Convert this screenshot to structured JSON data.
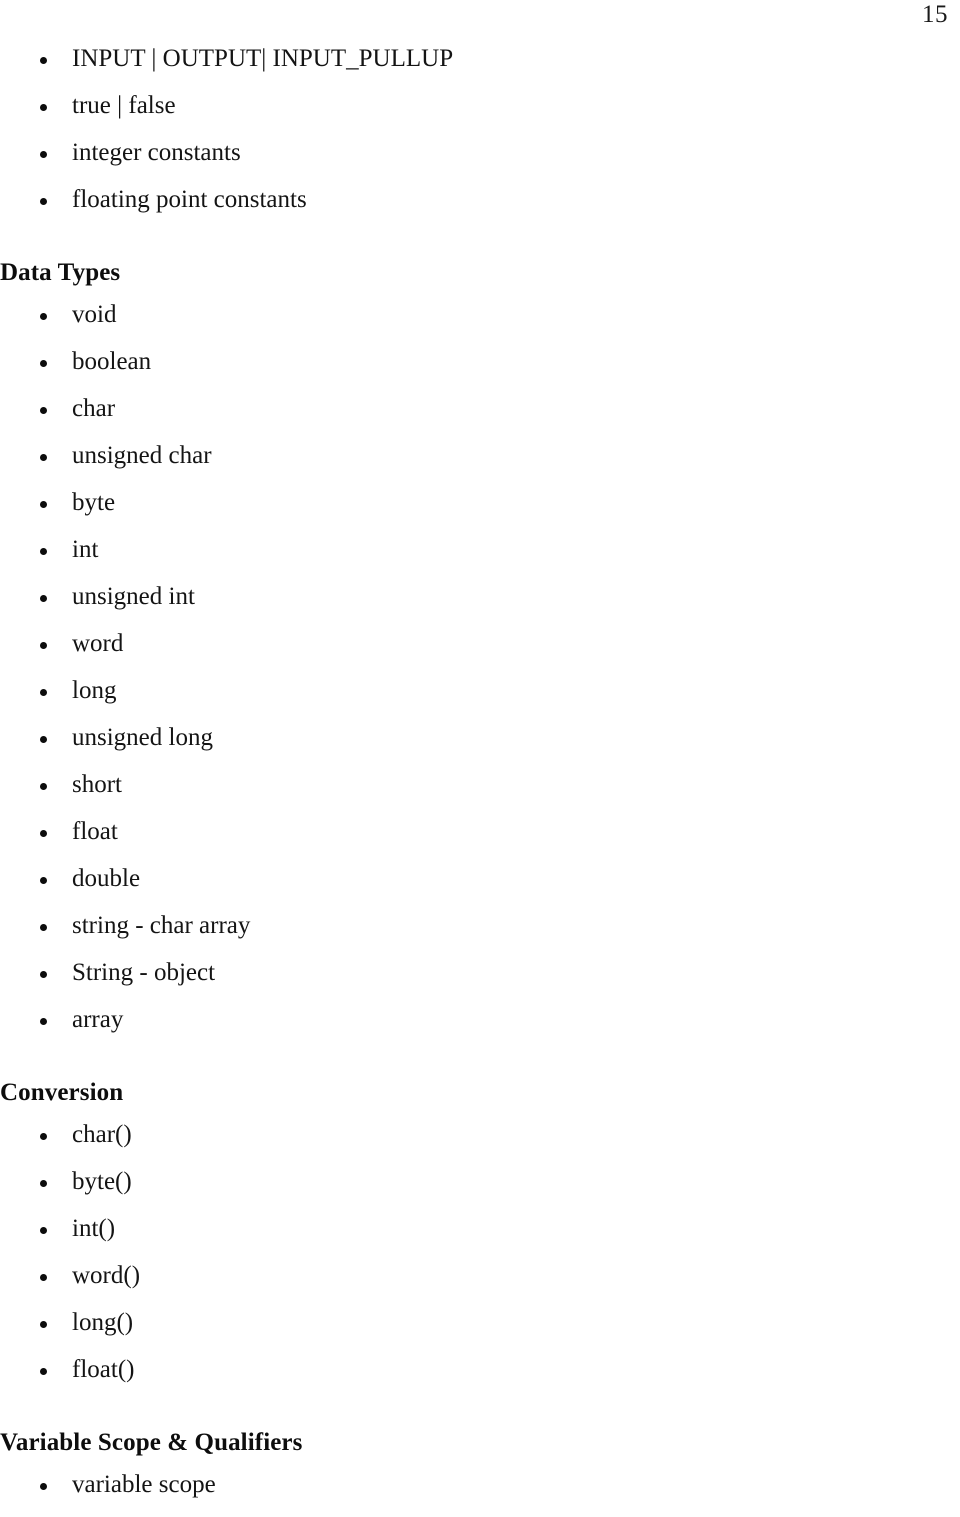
{
  "page": {
    "number": "15",
    "background_color": "#ffffff",
    "text_color": "#121212"
  },
  "blocks": [
    {
      "type": "list",
      "items": [
        "INPUT | OUTPUT| INPUT_PULLUP",
        "true | false",
        "integer constants",
        "floating point constants"
      ]
    },
    {
      "type": "heading",
      "text": "Data Types"
    },
    {
      "type": "list",
      "items": [
        "void",
        "boolean",
        "char",
        "unsigned char",
        "byte",
        "int",
        "unsigned int",
        "word",
        "long",
        "unsigned long",
        "short",
        "float",
        "double",
        "string - char array",
        "String - object",
        "array"
      ]
    },
    {
      "type": "heading",
      "text": "Conversion"
    },
    {
      "type": "list",
      "items": [
        "char()",
        "byte()",
        "int()",
        "word()",
        "long()",
        "float()"
      ]
    },
    {
      "type": "heading",
      "text": "Variable Scope & Qualifiers"
    },
    {
      "type": "list",
      "items": [
        "variable scope"
      ]
    }
  ]
}
